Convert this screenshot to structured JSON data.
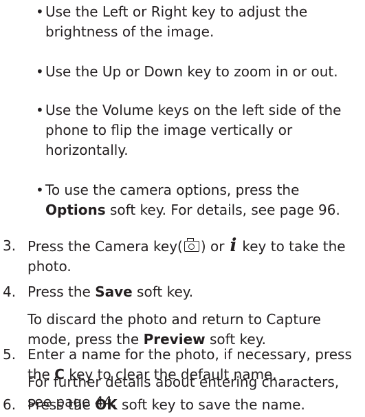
{
  "bullets": [
    {
      "dot": "•",
      "text": "Use the Left or Right key to adjust the brightness of the image."
    },
    {
      "dot": "•",
      "text": "Use the Up or Down key to zoom in or out."
    },
    {
      "dot": "•",
      "text": "Use the Volume keys on the left side of the phone to flip the image vertically or horizontally."
    },
    {
      "dot": "•",
      "pre": "To use the camera options, press the ",
      "bold": "Options",
      "post": " soft key. For details, see page 96."
    }
  ],
  "steps": [
    {
      "num": "3.",
      "pre": "Press the Camera key(",
      "mid": ") or",
      "key": "i",
      "post": "key to take the photo."
    },
    {
      "num": "4.",
      "pre": "Press the ",
      "bold": "Save",
      "post": " soft key."
    },
    {
      "num": "5.",
      "text": "Enter a name for the photo, if necessary, press the ",
      "bold": "C",
      "post": " key to clear the default name."
    },
    {
      "num": "6.",
      "pre": "Press the ",
      "bold": "OK",
      "post": " soft key to save the name."
    }
  ],
  "notes": [
    {
      "pre": "To discard the photo and return to Capture mode, press the ",
      "bold": "Preview",
      "post": " soft key."
    },
    {
      "text": "For further details about entering characters, see page 44."
    }
  ],
  "icons": {
    "camera_key": "camera-icon",
    "i_key": "i-key-icon"
  }
}
